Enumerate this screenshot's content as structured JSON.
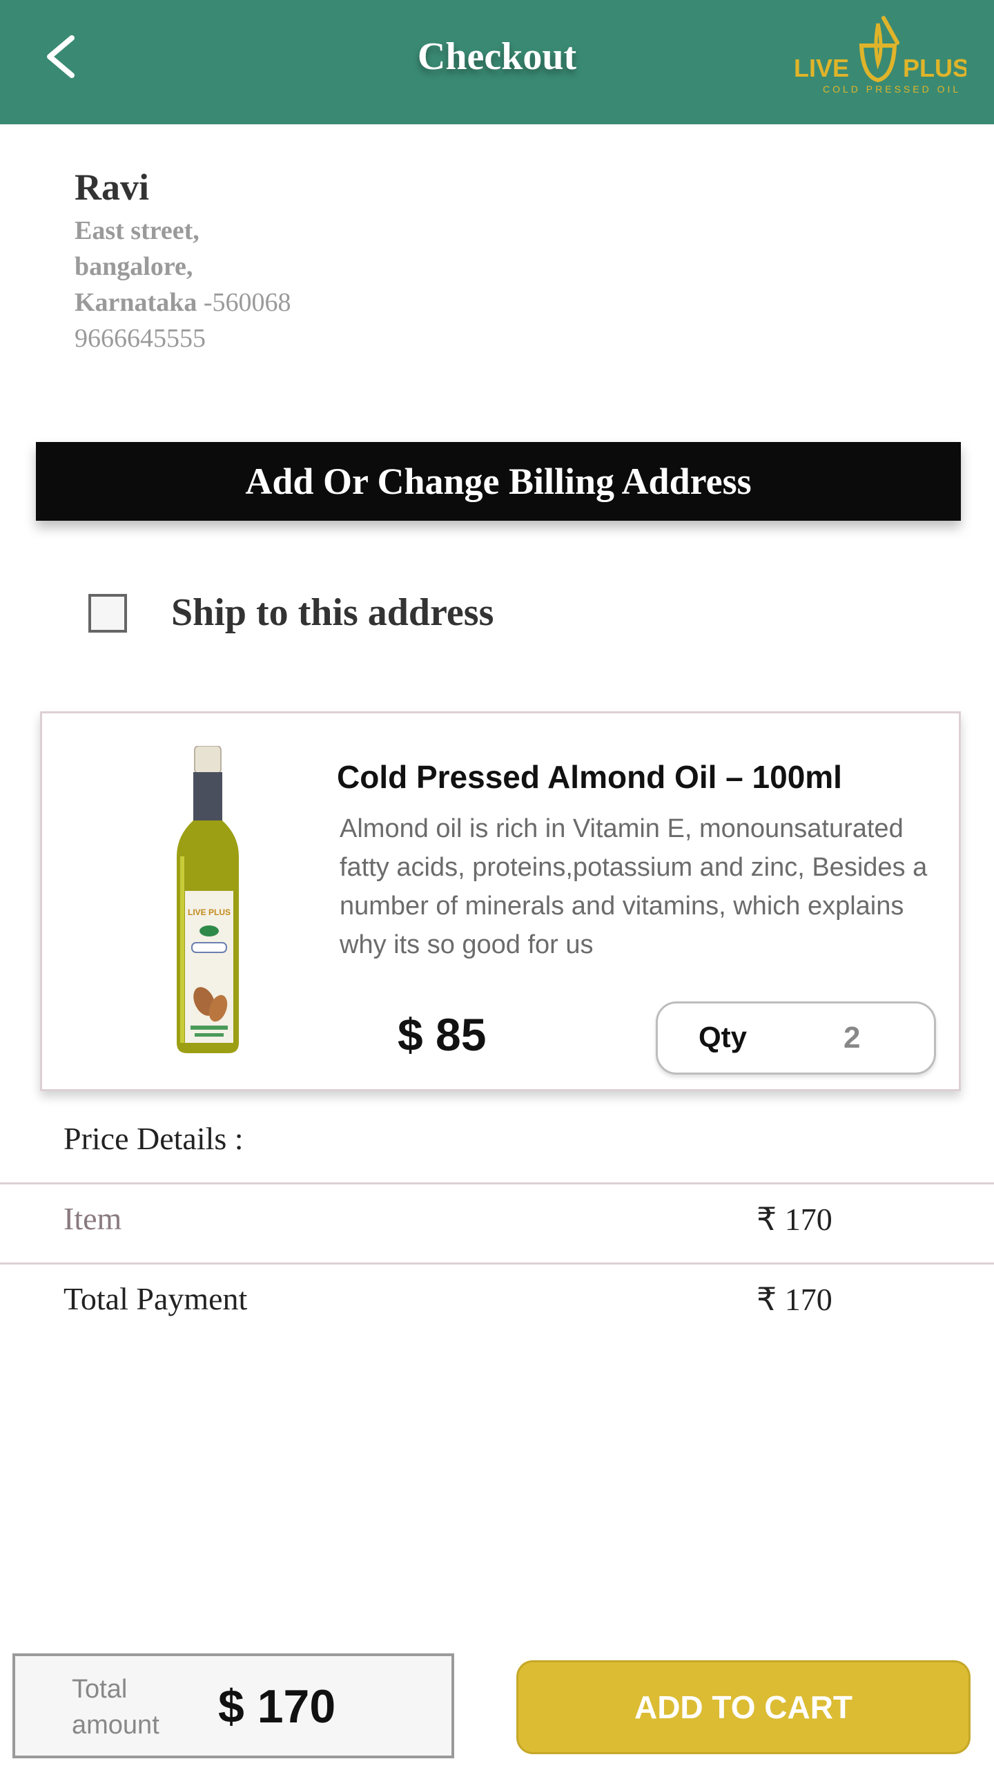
{
  "header": {
    "title": "Checkout",
    "back_icon": "chevron-left-icon",
    "logo": {
      "brand": "LIVE PLUS",
      "tagline": "COLD PRESSED OIL"
    },
    "background_color": "#3a8a73"
  },
  "address": {
    "name": "Ravi",
    "line1": "East street,",
    "line2": "bangalore,",
    "state": "Karnataka",
    "pin": " -560068",
    "phone": "9666645555"
  },
  "billing_button": {
    "label": "Add Or Change Billing Address"
  },
  "ship_option": {
    "label": "Ship to this address",
    "checked": false
  },
  "product": {
    "title": "Cold Pressed Almond Oil – 100ml",
    "description": "Almond oil is rich in Vitamin E, monounsaturated fatty acids, proteins,potassium and zinc, Besides a number of minerals and vitamins, which explains why its so good for us",
    "price": "$ 85",
    "qty_label": "Qty",
    "qty_value": "2",
    "image_icon": "oil-bottle-icon"
  },
  "price_details": {
    "title": "Price Details :",
    "item_label": "Item",
    "item_value": "₹ 170",
    "total_label": "Total Payment",
    "total_value": "₹ 170"
  },
  "footer": {
    "total_label": "Total amount",
    "total_value": "$ 170",
    "cart_button": "ADD TO CART",
    "accent_color": "#dcbc33"
  }
}
